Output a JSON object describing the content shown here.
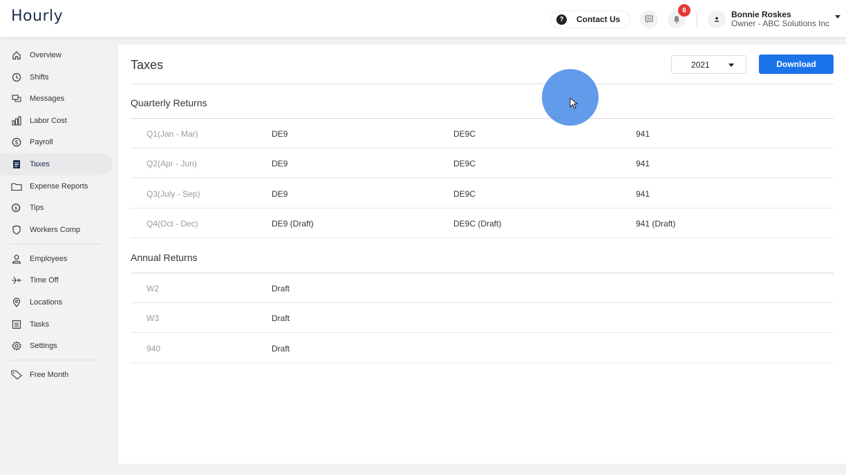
{
  "header": {
    "logo": "Hourly",
    "contact_label": "Contact Us",
    "notification_count": "6",
    "user_name": "Bonnie Roskes",
    "user_role": "Owner - ABC Solutions Inc"
  },
  "sidebar": {
    "items": [
      {
        "label": "Overview",
        "icon": "home-icon"
      },
      {
        "label": "Shifts",
        "icon": "clock-icon"
      },
      {
        "label": "Messages",
        "icon": "messages-icon"
      },
      {
        "label": "Labor Cost",
        "icon": "bar-chart-icon"
      },
      {
        "label": "Payroll",
        "icon": "dollar-circle-icon"
      },
      {
        "label": "Taxes",
        "icon": "document-icon",
        "active": true
      },
      {
        "label": "Expense Reports",
        "icon": "folder-icon"
      },
      {
        "label": "Tips",
        "icon": "tips-icon"
      },
      {
        "label": "Workers Comp",
        "icon": "shield-icon"
      },
      {
        "label": "Employees",
        "icon": "person-icon"
      },
      {
        "label": "Time Off",
        "icon": "plane-icon"
      },
      {
        "label": "Locations",
        "icon": "location-pin-icon"
      },
      {
        "label": "Tasks",
        "icon": "list-icon"
      },
      {
        "label": "Settings",
        "icon": "gear-icon"
      },
      {
        "label": "Free Month",
        "icon": "tag-icon"
      }
    ]
  },
  "main": {
    "title": "Taxes",
    "year": "2021",
    "download_label": "Download",
    "quarterly_title": "Quarterly Returns",
    "quarterly_rows": [
      {
        "period": "Q1(Jan - Mar)",
        "c1": "DE9",
        "c2": "DE9C",
        "c3": "941"
      },
      {
        "period": "Q2(Apr - Jun)",
        "c1": "DE9",
        "c2": "DE9C",
        "c3": "941"
      },
      {
        "period": "Q3(July - Sep)",
        "c1": "DE9",
        "c2": "DE9C",
        "c3": "941"
      },
      {
        "period": "Q4(Oct - Dec)",
        "c1": "DE9 (Draft)",
        "c2": "DE9C (Draft)",
        "c3": "941 (Draft)"
      }
    ],
    "annual_title": "Annual Returns",
    "annual_rows": [
      {
        "period": "W2",
        "c1": "Draft"
      },
      {
        "period": "W3",
        "c1": "Draft"
      },
      {
        "period": "940",
        "c1": "Draft"
      }
    ]
  },
  "colors": {
    "accent": "#1a73e8",
    "badge": "#e53935",
    "logo": "#1f2d4d",
    "active_nav_bg": "#e9e9ec"
  }
}
